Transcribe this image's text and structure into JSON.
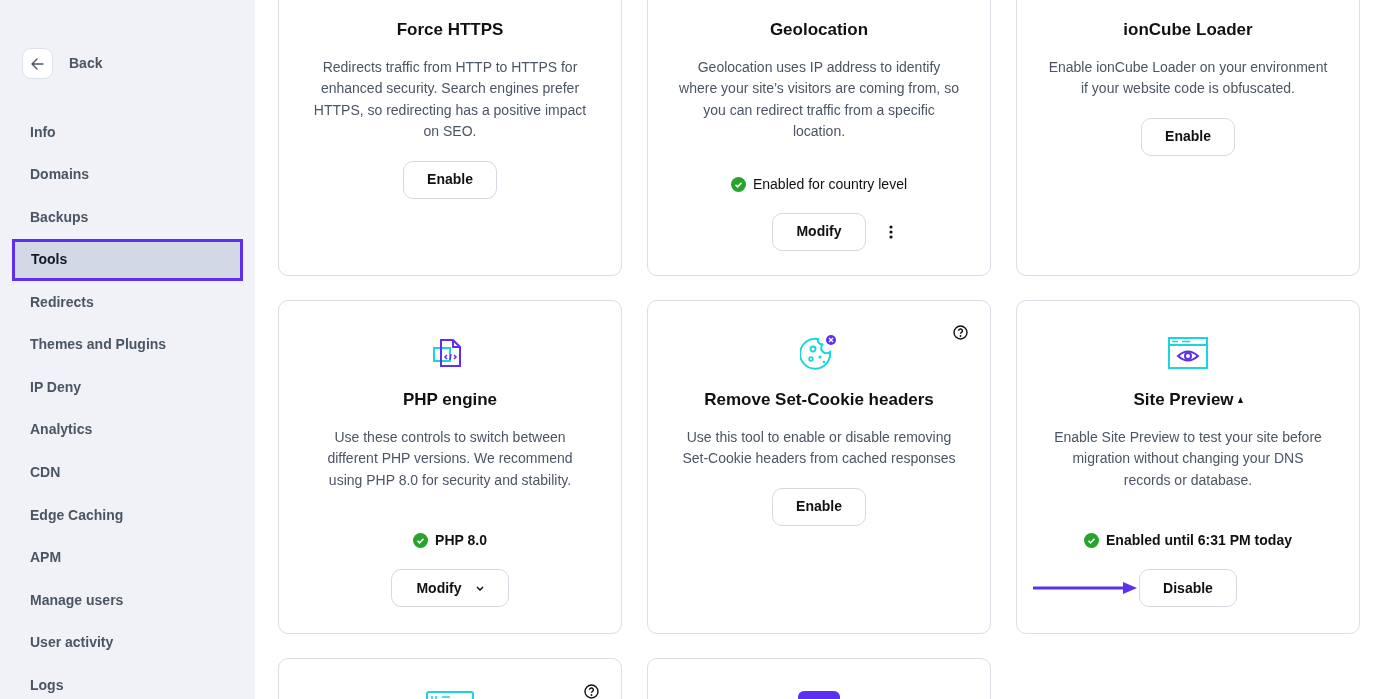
{
  "sidebar": {
    "back_label": "Back",
    "items": [
      {
        "label": "Info",
        "selected": false
      },
      {
        "label": "Domains",
        "selected": false
      },
      {
        "label": "Backups",
        "selected": false
      },
      {
        "label": "Tools",
        "selected": true
      },
      {
        "label": "Redirects",
        "selected": false
      },
      {
        "label": "Themes and Plugins",
        "selected": false
      },
      {
        "label": "IP Deny",
        "selected": false
      },
      {
        "label": "Analytics",
        "selected": false
      },
      {
        "label": "CDN",
        "selected": false
      },
      {
        "label": "Edge Caching",
        "selected": false
      },
      {
        "label": "APM",
        "selected": false
      },
      {
        "label": "Manage users",
        "selected": false
      },
      {
        "label": "User activity",
        "selected": false
      },
      {
        "label": "Logs",
        "selected": false
      }
    ]
  },
  "cards": [
    {
      "title": "Force HTTPS",
      "description": "Redirects traffic from HTTP to HTTPS for enhanced security. Search engines prefer HTTPS, so redirecting has a positive impact on SEO.",
      "button": {
        "label": "Enable",
        "kind": "plain"
      }
    },
    {
      "title": "Geolocation",
      "description": "Geolocation uses IP address to identify where your site’s visitors are coming from, so you can redirect traffic from a specific location.",
      "status": "Enabled for country level",
      "button": {
        "label": "Modify",
        "kind": "plain"
      },
      "more_menu": true
    },
    {
      "title": "ionCube Loader",
      "description": "Enable ionCube Loader on your environment if your website code is obfuscated.",
      "button": {
        "label": "Enable",
        "kind": "plain"
      }
    },
    {
      "title": "PHP engine",
      "description": "Use these controls to switch between different PHP versions. We recommend using PHP 8.0 for security and stability.",
      "status": "PHP 8.0",
      "button": {
        "label": "Modify",
        "kind": "dropdown"
      }
    },
    {
      "help": true,
      "title": "Remove Set-Cookie headers",
      "description": "Use this tool to enable or disable removing Set-Cookie headers from cached responses",
      "button": {
        "label": "Enable",
        "kind": "plain"
      }
    },
    {
      "title_mark": true,
      "title": "Site Preview",
      "description": "Enable Site Preview to test your site before migration without changing your DNS records or database.",
      "status": "Enabled until 6:31 PM today",
      "button": {
        "label": "Disable",
        "kind": "plain"
      },
      "pointer_arrow": true
    },
    {
      "help": true
    },
    {
      "help": false
    }
  ]
}
